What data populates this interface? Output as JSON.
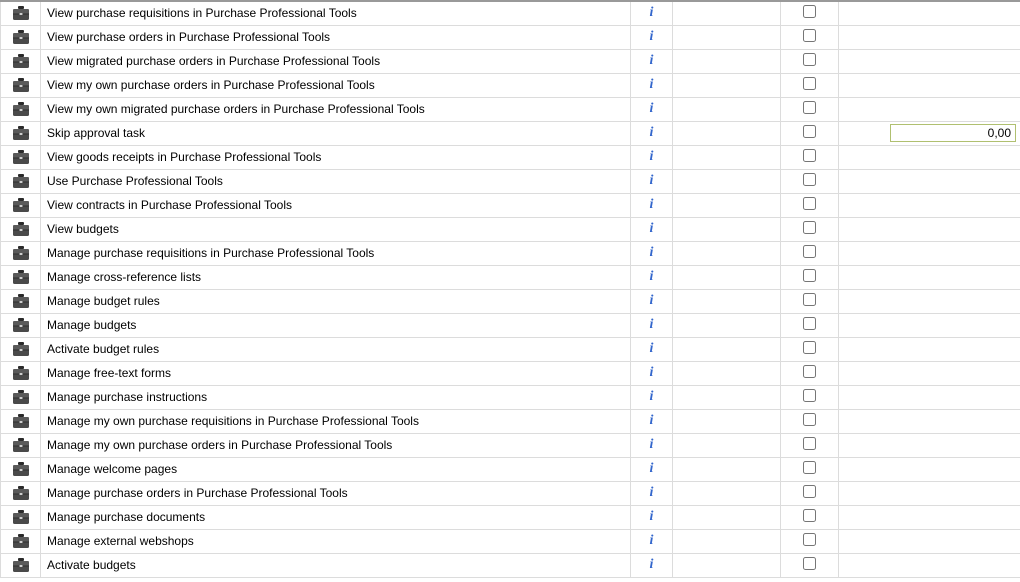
{
  "rows": [
    {
      "name": "View purchase requisitions in Purchase Professional Tools",
      "checked": false,
      "value": null
    },
    {
      "name": "View purchase orders in Purchase Professional Tools",
      "checked": false,
      "value": null
    },
    {
      "name": "View migrated purchase orders in Purchase Professional Tools",
      "checked": false,
      "value": null
    },
    {
      "name": "View my own purchase orders in Purchase Professional Tools",
      "checked": false,
      "value": null
    },
    {
      "name": "View my own migrated purchase orders in Purchase Professional Tools",
      "checked": false,
      "value": null
    },
    {
      "name": "Skip approval task",
      "checked": false,
      "value": "0,00"
    },
    {
      "name": "View goods receipts in Purchase Professional Tools",
      "checked": false,
      "value": null
    },
    {
      "name": "Use Purchase Professional Tools",
      "checked": false,
      "value": null
    },
    {
      "name": "View contracts in Purchase Professional Tools",
      "checked": false,
      "value": null
    },
    {
      "name": "View budgets",
      "checked": false,
      "value": null
    },
    {
      "name": "Manage purchase requisitions in Purchase Professional Tools",
      "checked": false,
      "value": null
    },
    {
      "name": "Manage cross-reference lists",
      "checked": false,
      "value": null
    },
    {
      "name": "Manage budget rules",
      "checked": false,
      "value": null
    },
    {
      "name": "Manage budgets",
      "checked": false,
      "value": null
    },
    {
      "name": "Activate budget rules",
      "checked": false,
      "value": null
    },
    {
      "name": "Manage free-text forms",
      "checked": false,
      "value": null
    },
    {
      "name": "Manage purchase instructions",
      "checked": false,
      "value": null
    },
    {
      "name": "Manage my own purchase requisitions in Purchase Professional Tools",
      "checked": false,
      "value": null
    },
    {
      "name": "Manage my own purchase orders in Purchase Professional Tools",
      "checked": false,
      "value": null
    },
    {
      "name": "Manage welcome pages",
      "checked": false,
      "value": null
    },
    {
      "name": "Manage purchase orders in Purchase Professional Tools",
      "checked": false,
      "value": null
    },
    {
      "name": "Manage purchase documents",
      "checked": false,
      "value": null
    },
    {
      "name": "Manage external webshops",
      "checked": false,
      "value": null
    },
    {
      "name": "Activate budgets",
      "checked": false,
      "value": null
    }
  ],
  "info_glyph": "i"
}
